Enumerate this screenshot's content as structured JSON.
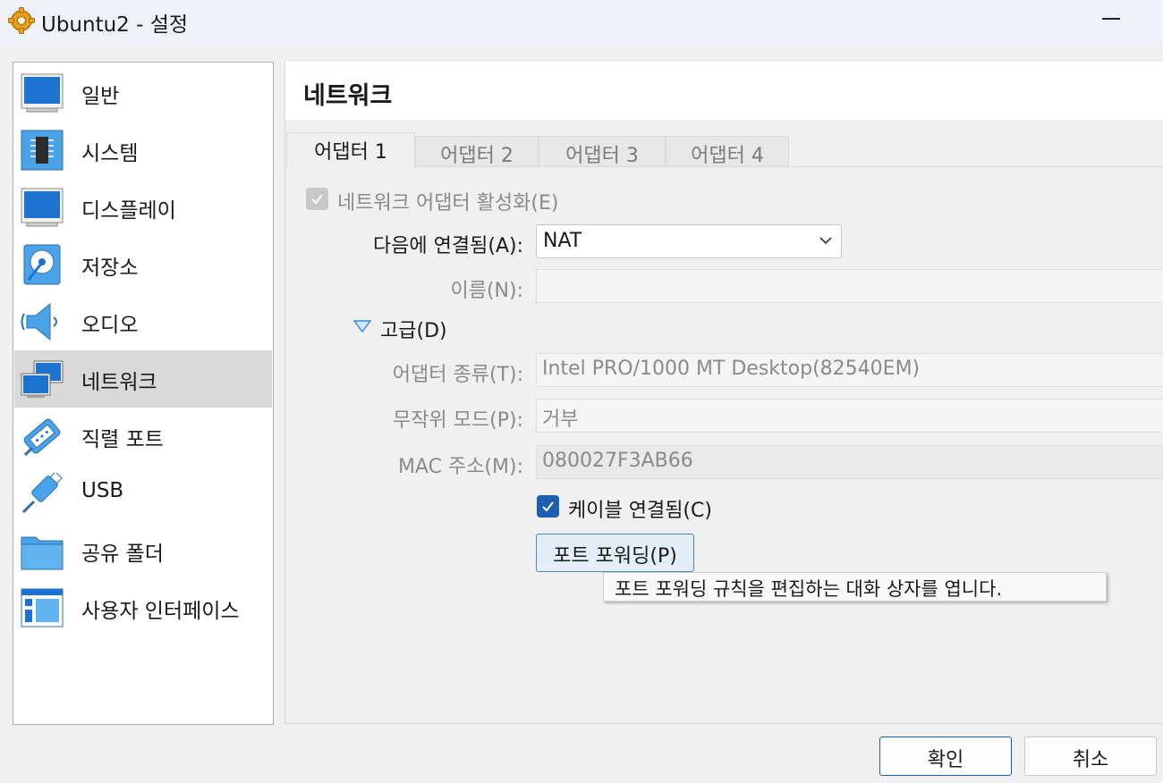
{
  "window": {
    "title": "Ubuntu2 - 설정"
  },
  "sidebar": {
    "items": [
      {
        "label": "일반",
        "icon": "general-icon"
      },
      {
        "label": "시스템",
        "icon": "chip-icon"
      },
      {
        "label": "디스플레이",
        "icon": "display-icon"
      },
      {
        "label": "저장소",
        "icon": "disk-icon"
      },
      {
        "label": "오디오",
        "icon": "speaker-icon"
      },
      {
        "label": "네트워크",
        "icon": "network-icon",
        "selected": true
      },
      {
        "label": "직렬 포트",
        "icon": "serial-port-icon"
      },
      {
        "label": "USB",
        "icon": "usb-icon"
      },
      {
        "label": "공유 폴더",
        "icon": "folder-icon"
      },
      {
        "label": "사용자 인터페이스",
        "icon": "ui-layout-icon"
      }
    ]
  },
  "page": {
    "title": "네트워크"
  },
  "tabs": [
    {
      "label": "어댑터 1",
      "active": true
    },
    {
      "label": "어댑터 2"
    },
    {
      "label": "어댑터 3"
    },
    {
      "label": "어댑터 4"
    }
  ],
  "form": {
    "enable_adapter": {
      "label": "네트워크 어댑터 활성화(E)",
      "checked": true,
      "disabled": true
    },
    "attached_to": {
      "label": "다음에 연결됨(A):",
      "value": "NAT"
    },
    "name": {
      "label": "이름(N):",
      "value": ""
    },
    "advanced": {
      "label": "고급(D)",
      "expanded": true
    },
    "adapter_type": {
      "label": "어댑터 종류(T):",
      "value": "Intel PRO/1000 MT Desktop(82540EM)"
    },
    "promiscuous": {
      "label": "무작위 모드(P):",
      "value": "거부"
    },
    "mac": {
      "label": "MAC 주소(M):",
      "value": "080027F3AB66"
    },
    "cable_connected": {
      "label": "케이블 연결됨(C)",
      "checked": true
    },
    "port_forwarding": {
      "label": "포트 포워딩(P)"
    }
  },
  "tooltip": {
    "text": "포트 포워딩 규칙을 편집하는 대화 상자를 엽니다."
  },
  "buttons": {
    "ok": "확인",
    "cancel": "취소"
  },
  "colors": {
    "accent": "#1c5fb0",
    "selected_bg": "#d9d9d9",
    "icon_blue": "#1e73d2"
  }
}
